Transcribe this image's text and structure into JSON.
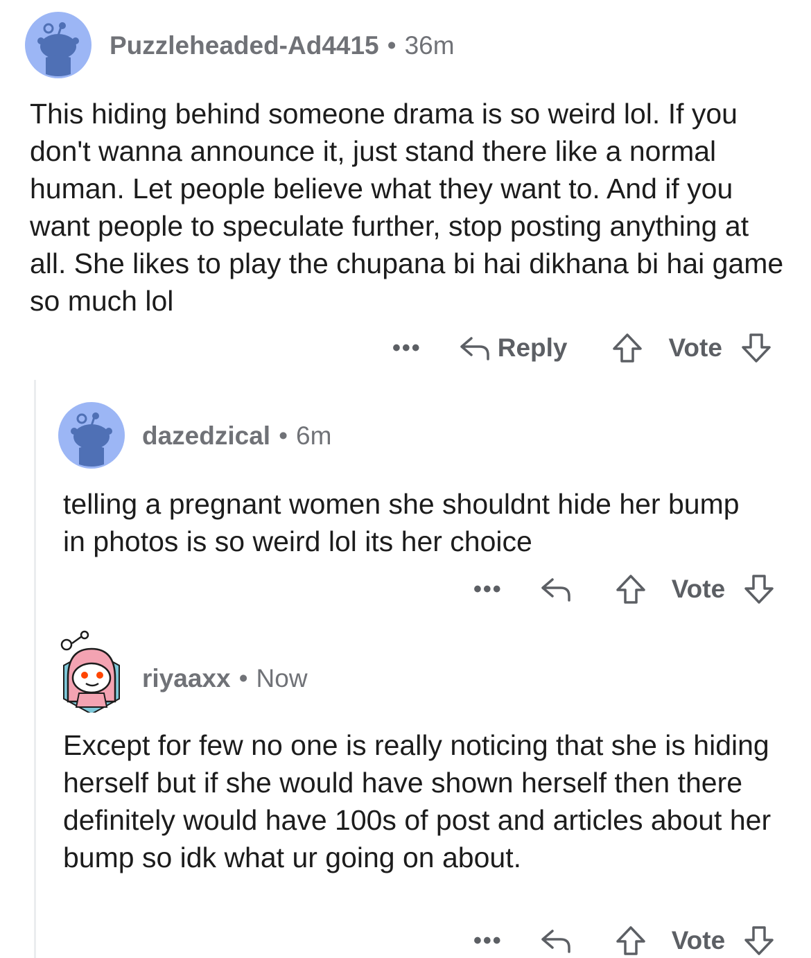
{
  "comments": [
    {
      "username": "Puzzleheaded-Ad4415",
      "separator": "•",
      "time": "36m",
      "body": "This hiding behind someone drama is so weird lol. If you don't wanna announce it, just stand there like a normal human. Let people believe what they want to. And if you want people to speculate further, stop posting anything at all. She likes to play the chupana bi hai dikhana bi hai game so much lol",
      "more_label": "•••",
      "reply_label": "Reply",
      "vote_label": "Vote",
      "avatar_icon": "snoo-default-avatar-icon"
    },
    {
      "username": "dazedzical",
      "separator": "•",
      "time": "6m",
      "body": "telling a pregnant women she shouldnt hide her bump in photos is so weird lol its her choice",
      "more_label": "•••",
      "vote_label": "Vote",
      "avatar_icon": "snoo-default-avatar-icon"
    },
    {
      "username": "riyaaxx",
      "separator": "•",
      "time": "Now",
      "body": "Except for few no one is really noticing that she is hiding herself but if she would have shown herself then there definitely would have 100s of post and articles about her bump so idk what ur going on about.",
      "more_label": "•••",
      "vote_label": "Vote",
      "avatar_icon": "snoo-custom-avatar-icon"
    }
  ],
  "colors": {
    "avatar_bg": "#9cb6f5",
    "snoo_body": "#4f70b5",
    "meta_text": "#707277",
    "body_text": "#1c1c1c",
    "thread_line": "#ebedef",
    "hijab_pink": "#f3a3b2"
  }
}
